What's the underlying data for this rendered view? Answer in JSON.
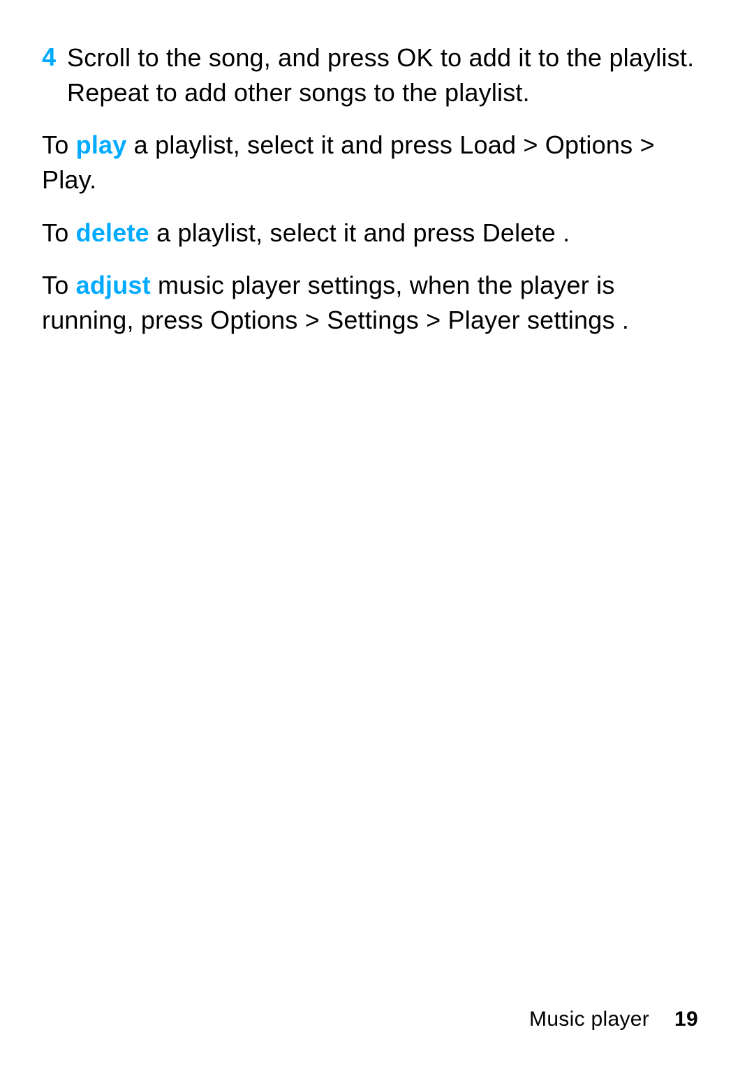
{
  "step4": {
    "number": "4",
    "text": "Scroll to the song, and press OK to add it to the playlist. Repeat to add other songs to the playlist."
  },
  "play": {
    "pre": "To ",
    "keyword": "play",
    "post": " a playlist, select it and press Load > Options > Play."
  },
  "delete": {
    "pre": "To ",
    "keyword": "delete",
    "post": " a playlist, select it and press Delete ."
  },
  "adjust": {
    "pre": "To ",
    "keyword": "adjust",
    "post": " music player settings, when the player is running, press Options  > Settings  > Player settings  ."
  },
  "footer": {
    "section": "Music player",
    "page": "19"
  }
}
